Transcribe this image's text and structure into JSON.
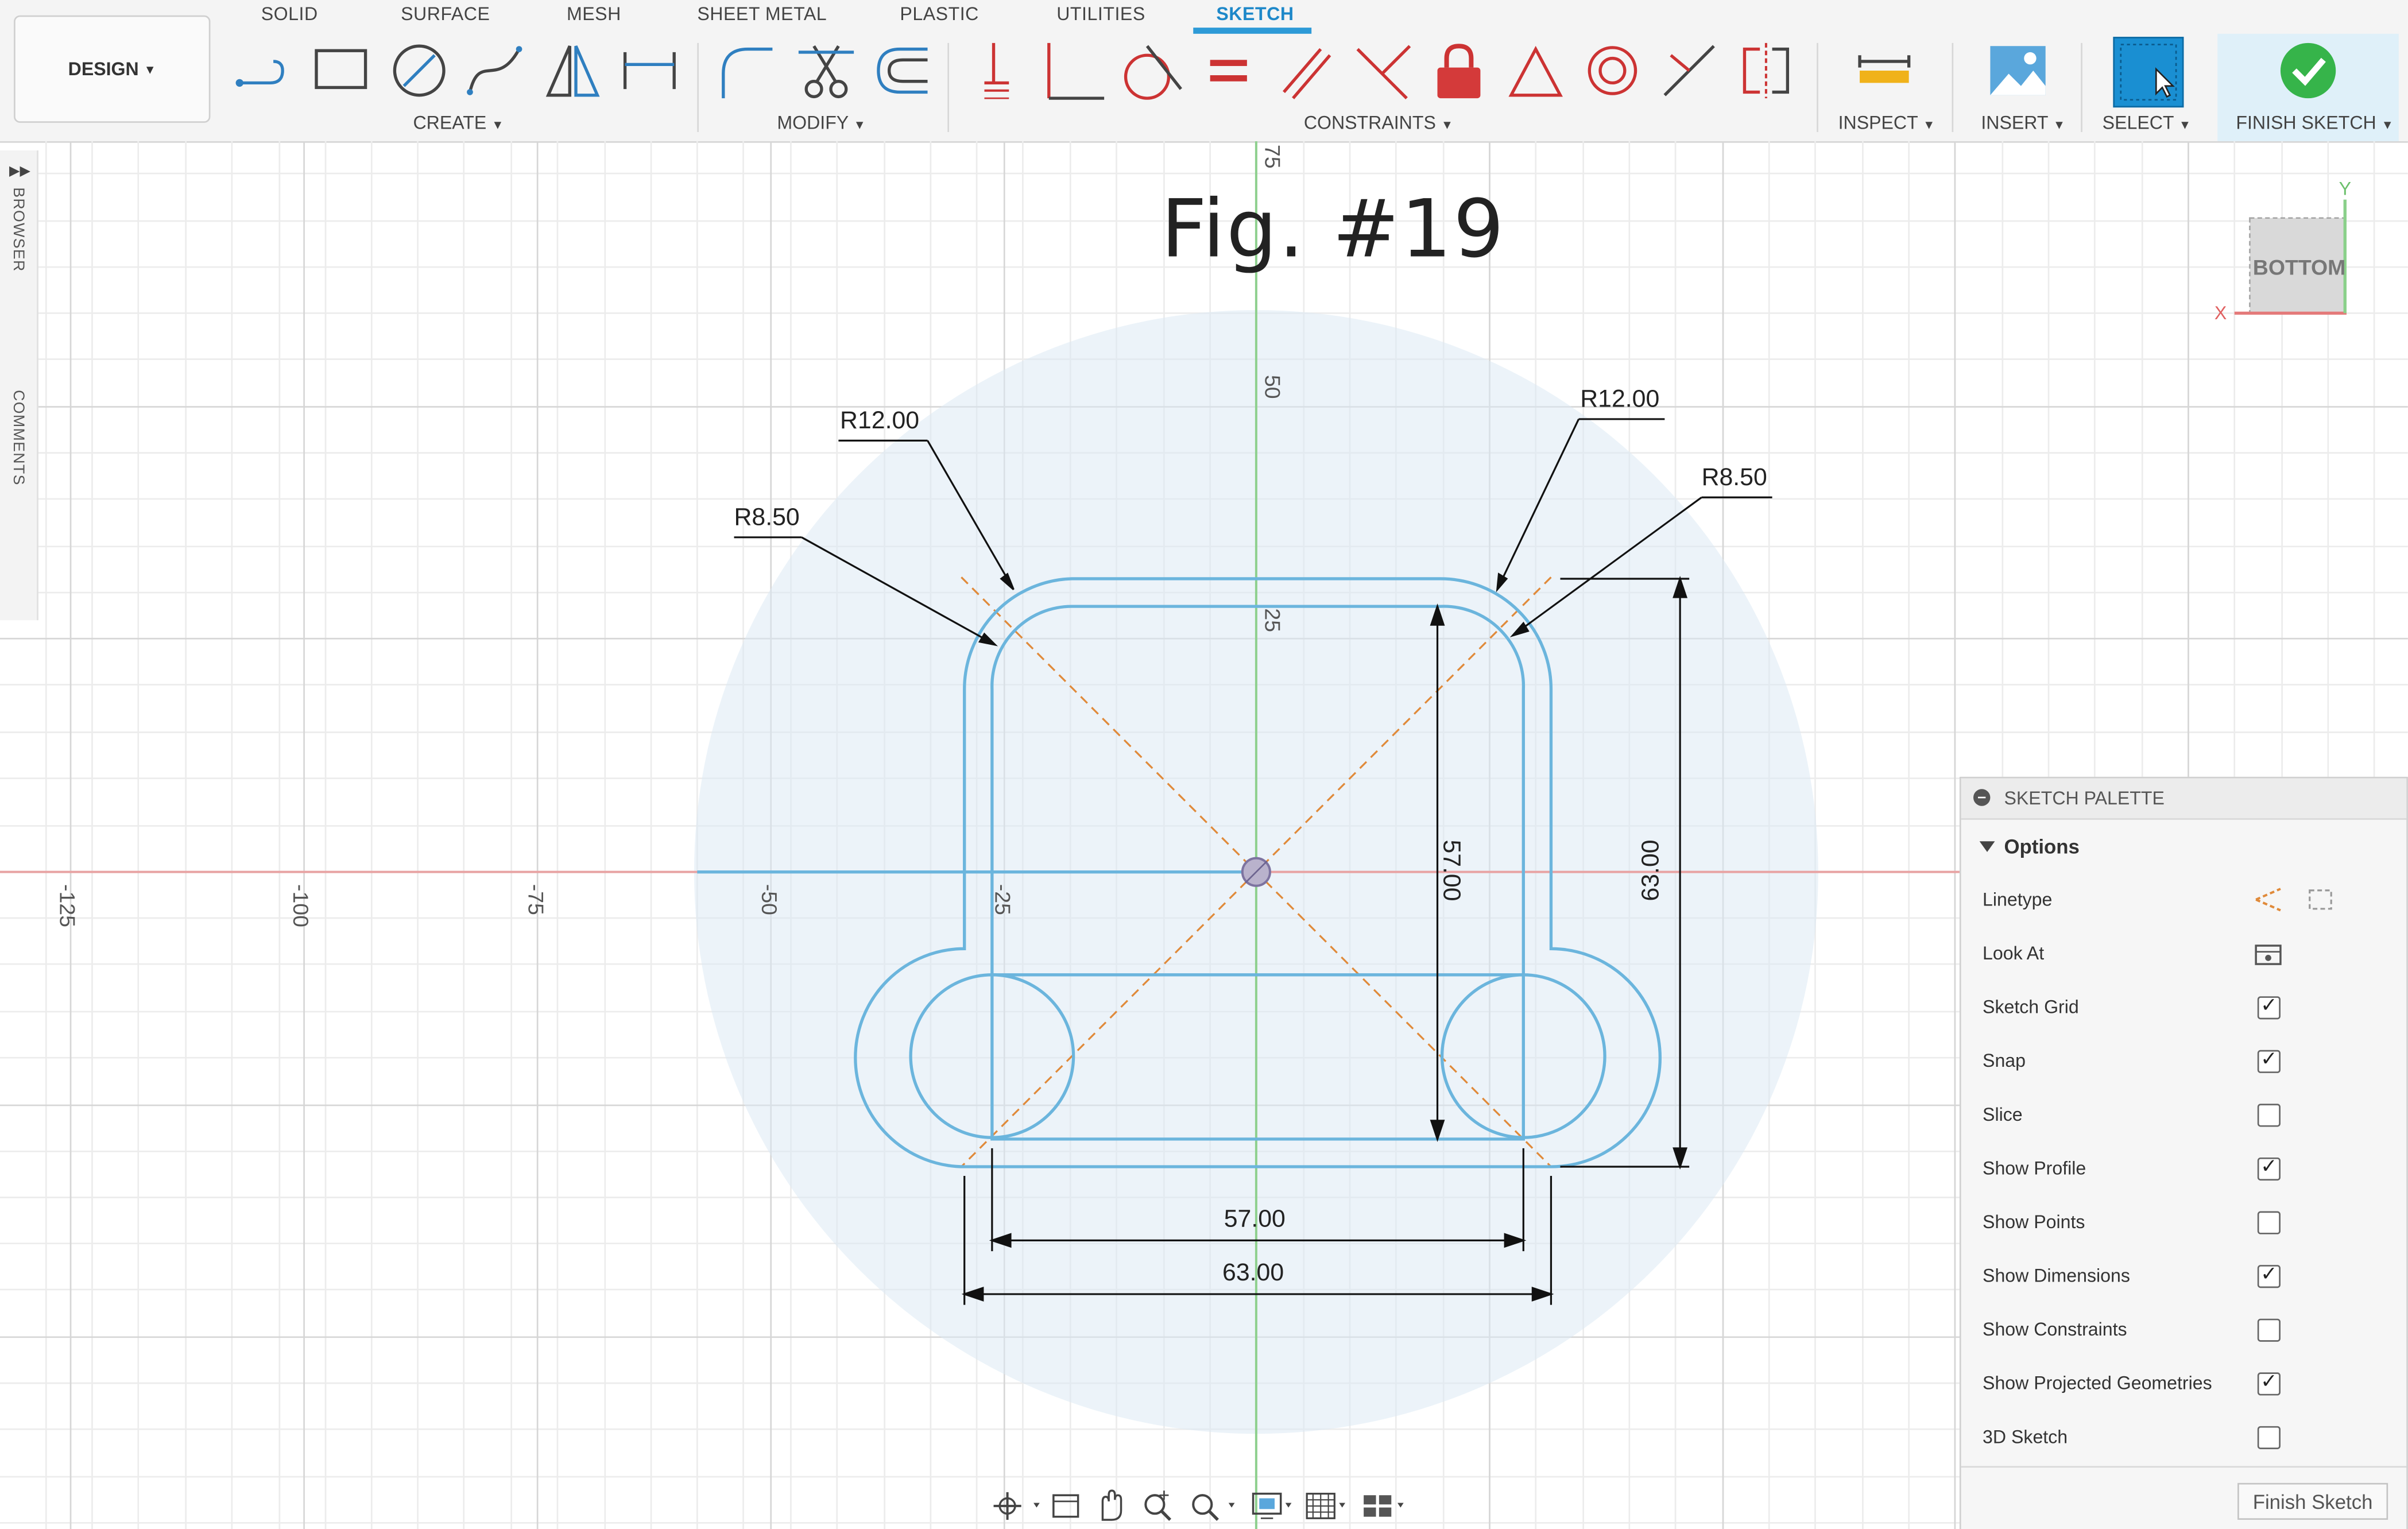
{
  "tabs": [
    "SOLID",
    "SURFACE",
    "MESH",
    "SHEET METAL",
    "PLASTIC",
    "UTILITIES",
    "SKETCH"
  ],
  "active_tab": "SKETCH",
  "workspace": "DESIGN",
  "groups": {
    "create": "CREATE",
    "modify": "MODIFY",
    "constraints": "CONSTRAINTS",
    "inspect": "INSPECT",
    "insert": "INSERT",
    "select": "SELECT",
    "finish": "FINISH SKETCH"
  },
  "side_panels": {
    "browser": "BROWSER",
    "comments": "COMMENTS"
  },
  "canvas": {
    "title": "Fig.  #19",
    "dims": {
      "r12_left": "R12.00",
      "r12_right": "R12.00",
      "r85_left": "R8.50",
      "r85_right": "R8.50",
      "inner_height": "57.00",
      "outer_height": "63.00",
      "inner_width": "57.00",
      "outer_width": "63.00"
    },
    "x_axis": [
      "-125",
      "-100",
      "-75",
      "-50",
      "-25"
    ],
    "y_axis": [
      "75",
      "50",
      "25"
    ]
  },
  "viewcube": {
    "face": "BOTTOM",
    "x": "X",
    "y": "Y"
  },
  "palette": {
    "title": "SKETCH PALETTE",
    "section": "Options",
    "options": [
      {
        "label": "Linetype",
        "kind": "icons"
      },
      {
        "label": "Look At",
        "kind": "icon"
      },
      {
        "label": "Sketch Grid",
        "kind": "check",
        "checked": true
      },
      {
        "label": "Snap",
        "kind": "check",
        "checked": true
      },
      {
        "label": "Slice",
        "kind": "check",
        "checked": false
      },
      {
        "label": "Show Profile",
        "kind": "check",
        "checked": true
      },
      {
        "label": "Show Points",
        "kind": "check",
        "checked": false
      },
      {
        "label": "Show Dimensions",
        "kind": "check",
        "checked": true
      },
      {
        "label": "Show Constraints",
        "kind": "check",
        "checked": false
      },
      {
        "label": "Show Projected Geometries",
        "kind": "check",
        "checked": true
      },
      {
        "label": "3D Sketch",
        "kind": "check",
        "checked": false
      }
    ],
    "finish_button": "Finish Sketch"
  },
  "colors": {
    "accent": "#2d9ad7",
    "sketch": "#6bb5dd",
    "construction": "#e08a3a",
    "x_axis": "#e8a3a3",
    "y_axis": "#8fd08f"
  }
}
